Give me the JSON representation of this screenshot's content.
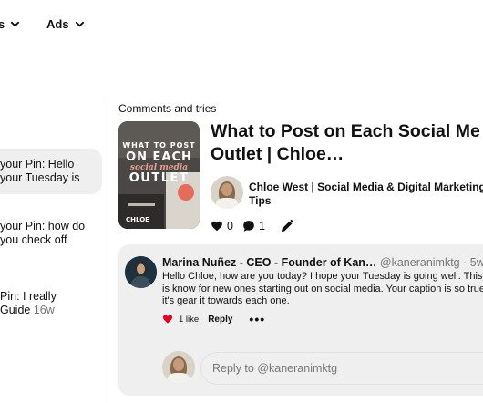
{
  "nav": {
    "items": [
      {
        "label": "s"
      },
      {
        "label": "Ads"
      }
    ]
  },
  "notifications": [
    {
      "line1": "your Pin: Hello",
      "line2": "your Tuesday is",
      "active": true
    },
    {
      "line1": "your Pin: how do",
      "line2": "you check off"
    },
    {
      "line1": "Pin: I really",
      "line2": "Guide",
      "time": "16w"
    }
  ],
  "main": {
    "section_title": "Comments and tries",
    "pin": {
      "title_line1": "What to Post on Each Social Me",
      "title_line2": "Outlet | Chloe…",
      "thumbnail_text": {
        "line1": "WHAT TO POST",
        "line2": "ON EACH",
        "line3": "social media",
        "line4": "OUTLET",
        "line5": "CHLOE"
      },
      "author": "Chloe West | Social Media & Digital Marketing Tips",
      "likes": "0",
      "comments": "1"
    },
    "comment": {
      "author": "Marina Nuñez - CEO - Founder of Kan…",
      "handle": "@kaneranimktg",
      "time": "5w",
      "handle_line": "@kaneranimktg · 5w",
      "text": "Hello Chloe, how are you today? I hope your Tuesday is going well. This is know for new ones starting out on social media. Your caption is so true it's gear it towards each one.",
      "like_count": "1 like",
      "reply_label": "Reply",
      "more_label": "•••"
    },
    "reply_box": {
      "placeholder": "Reply to @kaneranimktg"
    }
  },
  "colors": {
    "heart_red": "#e60023",
    "panel_gray": "#efefef",
    "muted_text": "#767676"
  },
  "icons": [
    "chevron-down-icon",
    "heart-icon",
    "comment-icon",
    "edit-pencil-icon",
    "more-icon"
  ]
}
